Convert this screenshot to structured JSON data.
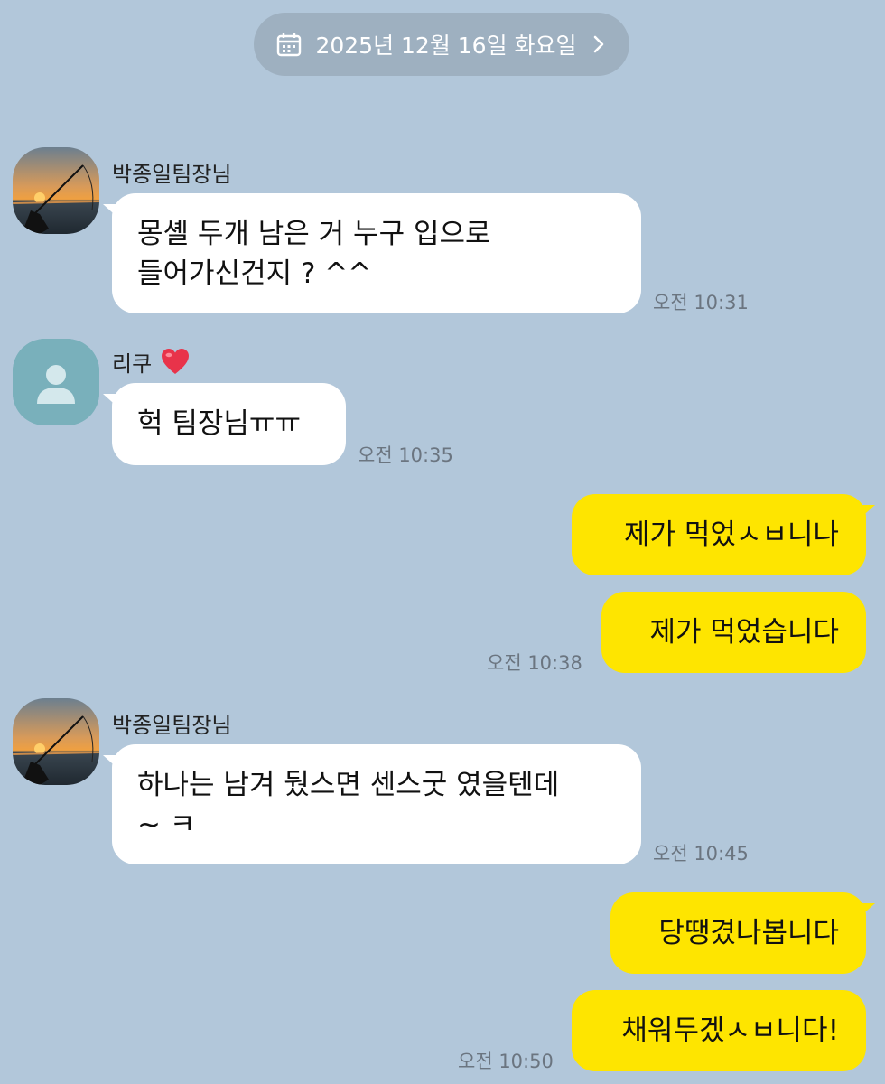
{
  "date_divider": {
    "text": "2025년 12월 16일 화요일",
    "icon": "calendar-icon",
    "chevron": "chevron-right-icon"
  },
  "messages": [
    {
      "sender": "박종일팀장님",
      "avatar": "fishing-sunset-avatar",
      "lines": [
        "몽셸 두개 남은 거 누구 입으로",
        "들어가신건지 ? ^^"
      ],
      "time": "오전 10:31"
    },
    {
      "sender": "리쿠",
      "avatar": "default-profile-avatar",
      "lines": [
        "헉 팀장님ㅠㅠ"
      ],
      "time": "오전 10:35"
    },
    {
      "from_me": true,
      "lines": [
        "제가 먹었ㅅㅂ니나"
      ]
    },
    {
      "from_me": true,
      "lines": [
        "제가 먹었습니다"
      ],
      "time": "오전 10:38"
    },
    {
      "sender": "박종일팀장님",
      "avatar": "fishing-sunset-avatar",
      "lines": [
        "하나는 남겨 뒀스면 센스굿 였을텐데",
        "~ ㅋ"
      ],
      "time": "오전 10:45"
    },
    {
      "from_me": true,
      "lines": [
        "당땡겼나봅니다"
      ]
    },
    {
      "from_me": true,
      "lines": [
        "채워두겠ㅅㅂ니다!"
      ],
      "time": "오전 10:50"
    }
  ],
  "colors": {
    "background": "#b2c7da",
    "incoming_bubble": "#ffffff",
    "outgoing_bubble": "#fee500",
    "date_pill": "#9eb0c0",
    "timestamp": "#6b7580"
  }
}
